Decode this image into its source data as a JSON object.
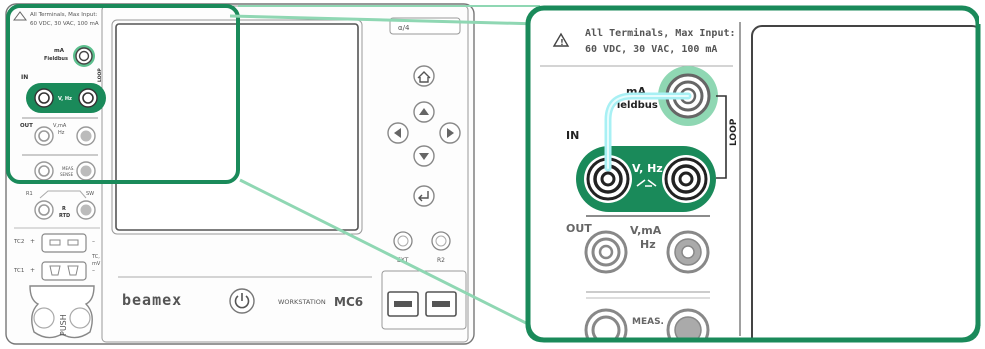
{
  "device": {
    "brand": "beamex",
    "model_prefix": "WORKSTATION",
    "model": "MC6",
    "top_tab": "α/4",
    "warning": {
      "line1": "All Terminals, Max Input:",
      "line2": "60 VDC, 30 VAC, 100 mA"
    },
    "terminals": {
      "ma_fieldbus_top": "mA",
      "ma_fieldbus_bottom": "Fieldbus",
      "loop": "LOOP",
      "in": "IN",
      "v_hz": "V, Hz",
      "out": "OUT",
      "v_ma_top": "V,mA",
      "v_ma_bottom": "Hz",
      "meas_top": "MEAS.",
      "meas_bottom": "SENSE",
      "r1": "R1",
      "sw": "SW",
      "r_top": "R",
      "r_bottom": "RTD",
      "tc2": "TC2",
      "tc1": "TC1",
      "tc_mv_top": "TC,",
      "tc_mv_bottom": "mV",
      "plus": "+",
      "minus": "–",
      "push": "PUSH",
      "ext": "EXT",
      "r2": "R2"
    },
    "nav_buttons": [
      "home",
      "up",
      "left",
      "right",
      "down",
      "enter"
    ]
  },
  "colors": {
    "highlight": "#1a8a5a",
    "cable": "#a8f0f4",
    "body_outline": "#555555",
    "panel_fill": "#f8f8f8"
  }
}
